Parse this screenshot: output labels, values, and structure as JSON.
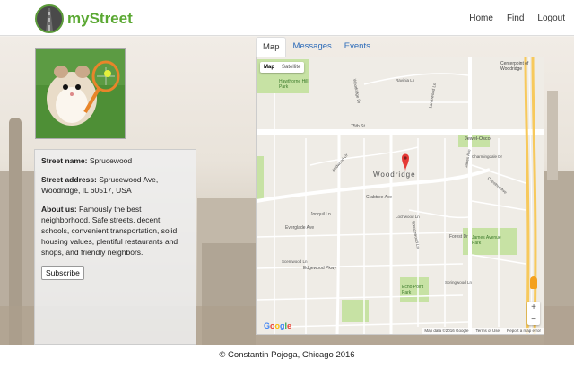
{
  "header": {
    "logo_text": "myStreet",
    "nav": [
      "Home",
      "Find",
      "Logout"
    ]
  },
  "street": {
    "name_label": "Street name:",
    "name": "Sprucewood",
    "address_label": "Street address:",
    "address": "Sprucewood Ave, Woodridge, IL 60517, USA",
    "about_label": "About us:",
    "about": "Famously the best neighborhood, Safe streets, decent schools, convenient transportation, solid housing values, plentiful restaurants and shops, and friendly neighbors.",
    "subscribe_label": "Subscribe"
  },
  "tabs": [
    "Map",
    "Messages",
    "Events"
  ],
  "map": {
    "type_options": [
      "Map",
      "Satellite"
    ],
    "selected_type": "Map",
    "city_label": "Woodridge",
    "place_labels": [
      "Hawthorne Hill Park",
      "Jewel-Osco",
      "Centerpoint of Woodridge",
      "James Avenue Park",
      "Echo Point Park"
    ],
    "road_labels": [
      "75th St",
      "Ravinia Ln",
      "Crabtree Ave",
      "Jonquil Ln",
      "Everglade Ave",
      "Edgewood Pkwy",
      "Forest Dr",
      "Woodridge Dr",
      "Janes Ave",
      "Wildwood Dr",
      "Scentwood Ln",
      "Sprucewood Ln",
      "Larchwood Ln",
      "Chestnut Ave",
      "Charmingdale Dr",
      "Lochwood Ln",
      "Springwood Ln"
    ],
    "zoom_in": "+",
    "zoom_out": "−",
    "attribution": [
      "Map data ©2016 Google",
      "Terms of Use",
      "Report a map error"
    ],
    "google": [
      "G",
      "o",
      "o",
      "g",
      "l",
      "e"
    ]
  },
  "footer": "© Constantin Pojoga, Chicago 2016"
}
